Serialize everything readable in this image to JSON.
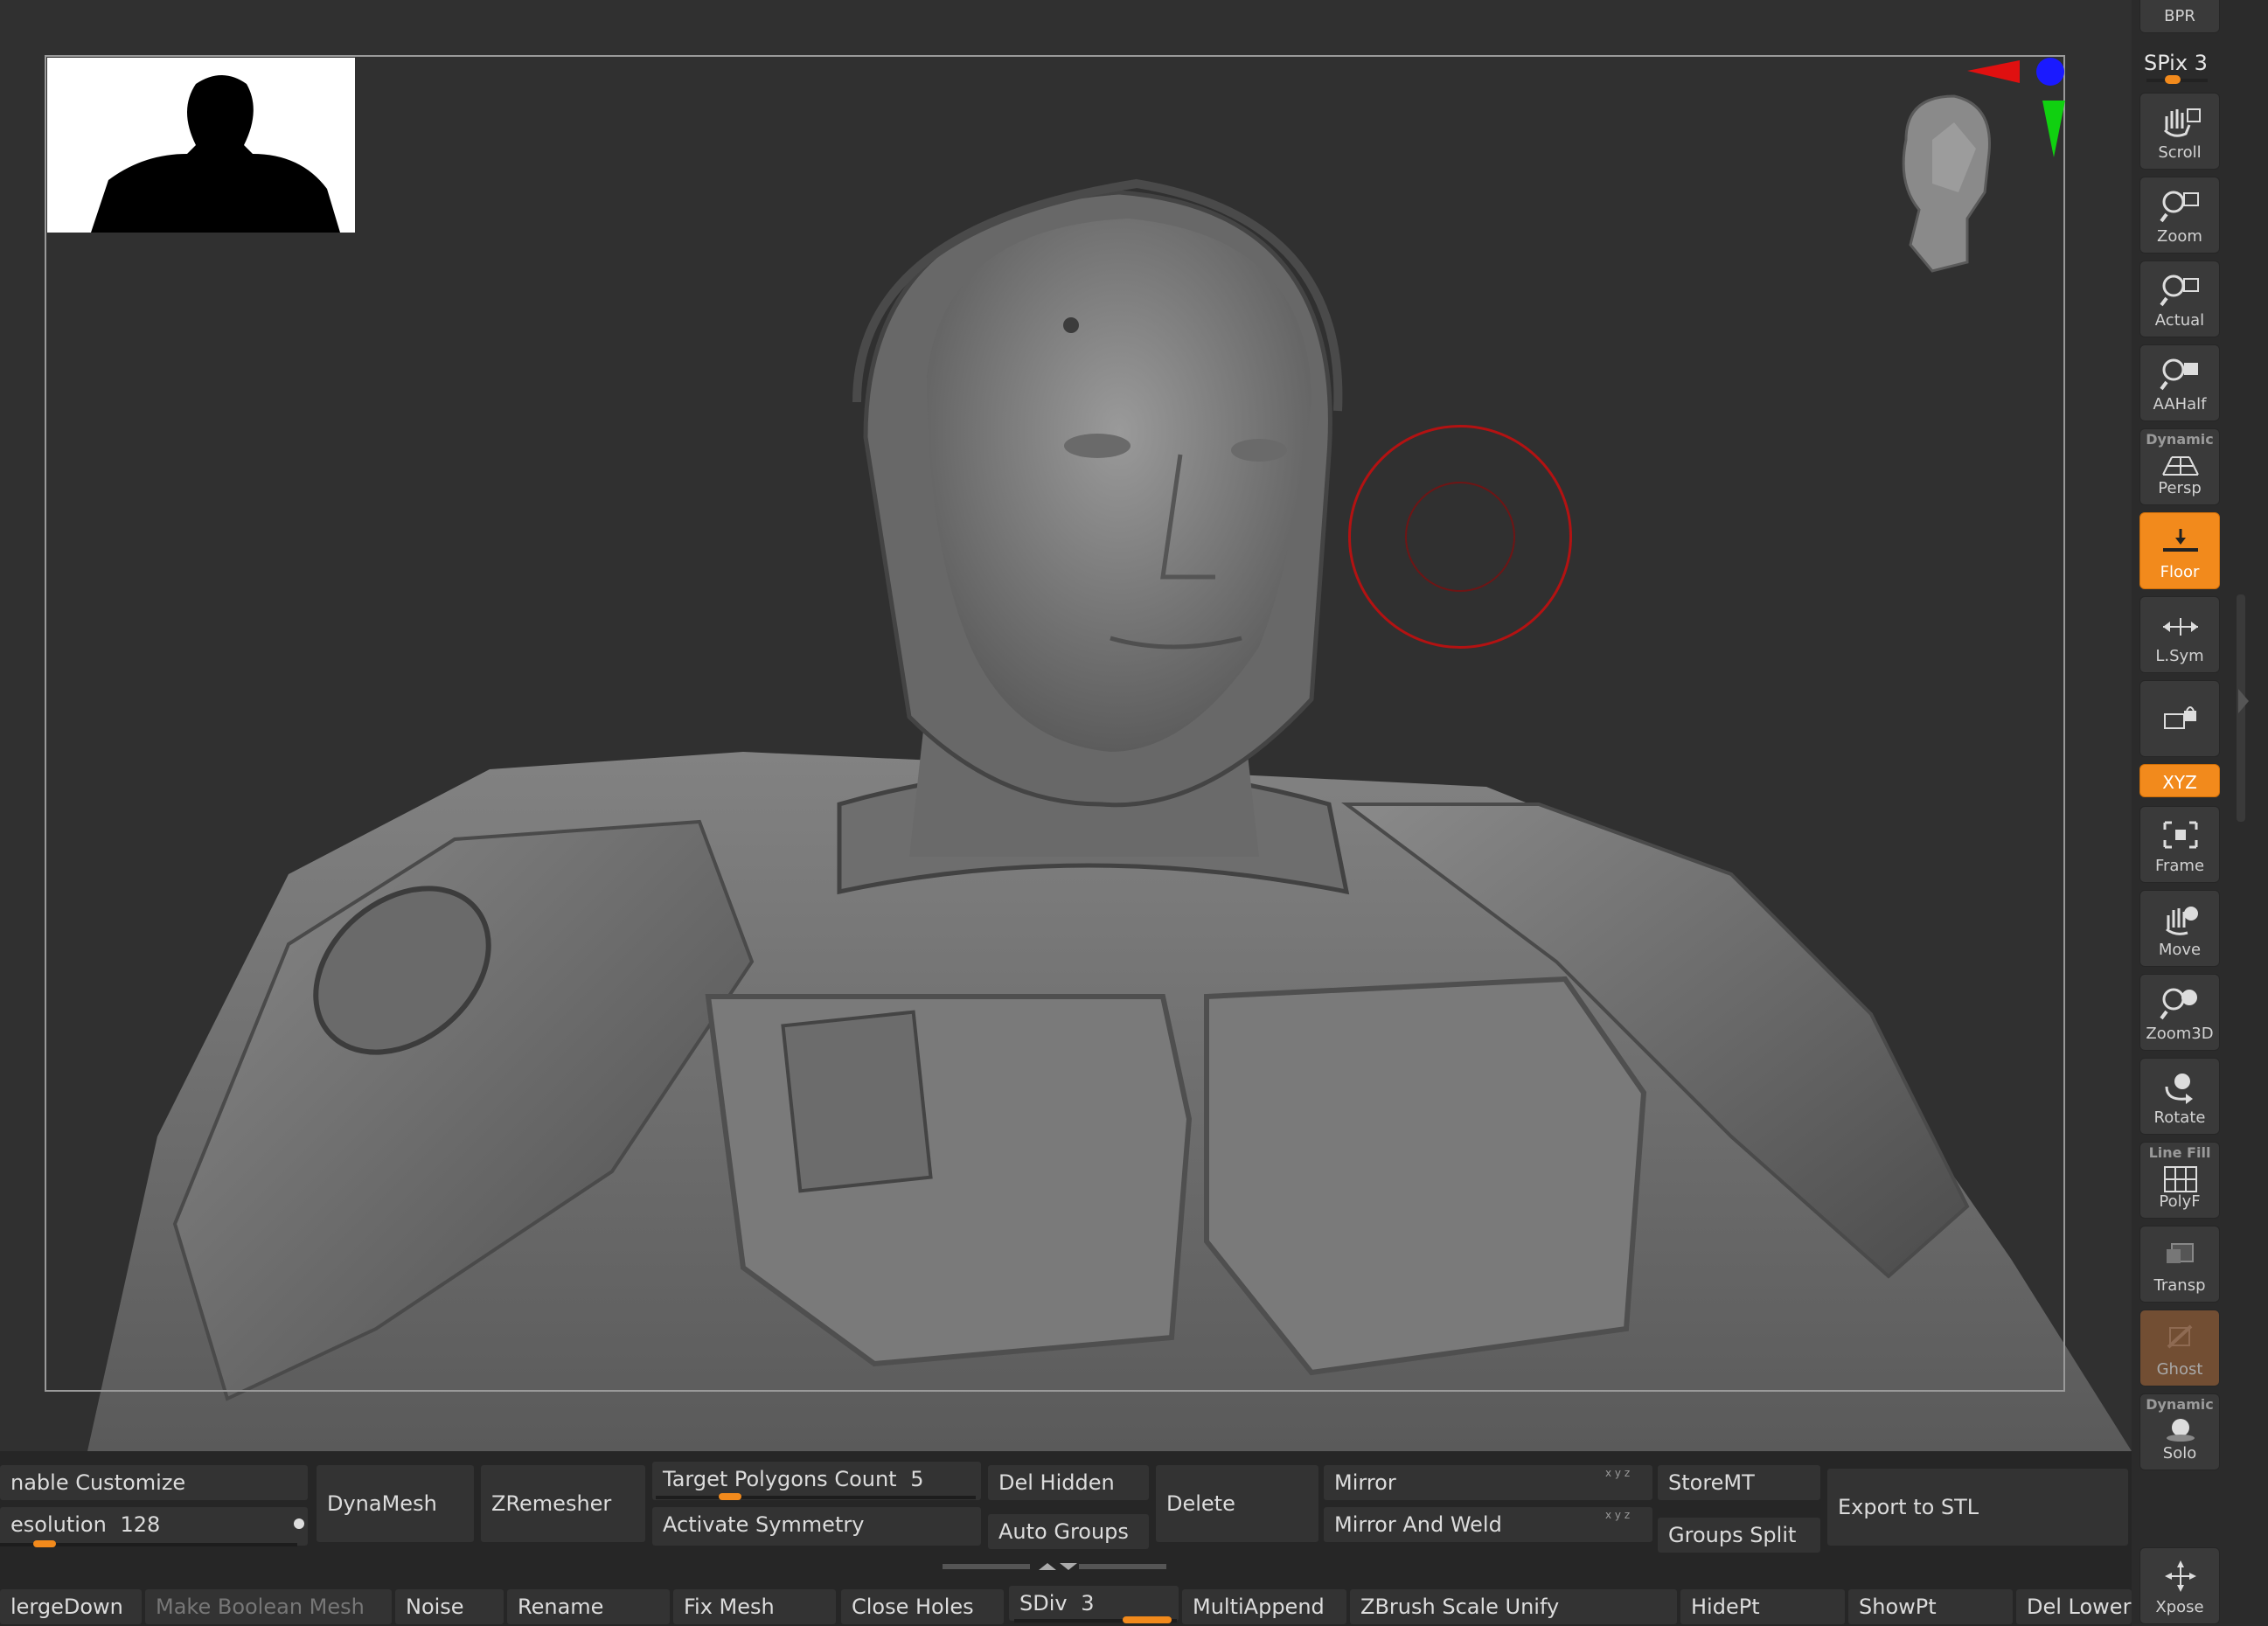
{
  "viewport": {
    "brush_color": "#b31212"
  },
  "right_shelf": {
    "bpr_label": "BPR",
    "spix_label": "SPix 3",
    "buttons": [
      {
        "label": "Scroll",
        "icon": "hand-scroll-icon"
      },
      {
        "label": "Zoom",
        "icon": "zoom-icon"
      },
      {
        "label": "Actual",
        "icon": "actual-size-icon"
      },
      {
        "label": "AAHalf",
        "icon": "aahalf-icon"
      },
      {
        "label": "Persp",
        "top": "Dynamic",
        "icon": "perspective-grid-icon"
      },
      {
        "label": "Floor",
        "icon": "floor-icon",
        "active": true
      },
      {
        "label": "L.Sym",
        "icon": "local-symmetry-icon"
      },
      {
        "label": "",
        "icon": "lock-camera-icon"
      },
      {
        "label": "XYZ",
        "icon": "xyz-rotate-icon",
        "active": true
      },
      {
        "label": "Frame",
        "icon": "frame-icon"
      },
      {
        "label": "Move",
        "icon": "move-hand-icon"
      },
      {
        "label": "Zoom3D",
        "icon": "zoom3d-icon"
      },
      {
        "label": "Rotate",
        "icon": "rotate-icon"
      },
      {
        "label": "PolyF",
        "top": "Line Fill",
        "icon": "polyframe-icon"
      },
      {
        "label": "Transp",
        "icon": "transparency-icon"
      },
      {
        "label": "Ghost",
        "icon": "ghost-icon"
      },
      {
        "label": "Solo",
        "top": "Dynamic",
        "icon": "solo-icon"
      },
      {
        "label": "Xpose",
        "icon": "xpose-icon"
      }
    ],
    "accent": "#f28a1c"
  },
  "bottom": {
    "enable_customize": "nable Customize",
    "resolution_label": "esolution",
    "resolution_value": "128",
    "dynamesh": "DynaMesh",
    "zremesher": "ZRemesher",
    "target_polygons_label": "Target Polygons Count",
    "target_polygons_value": "5",
    "activate_symmetry": "Activate Symmetry",
    "del_hidden": "Del Hidden",
    "auto_groups": "Auto Groups",
    "delete": "Delete",
    "mirror": "Mirror",
    "mirror_and_weld": "Mirror And Weld",
    "storemt": "StoreMT",
    "groups_split": "Groups Split",
    "export_stl": "Export to STL",
    "merge_down": "lergeDown",
    "make_boolean_mesh": "Make Boolean Mesh",
    "noise": "Noise",
    "rename": "Rename",
    "fix_mesh": "Fix Mesh",
    "close_holes": "Close Holes",
    "sdiv_label": "SDiv",
    "sdiv_value": "3",
    "multiappend": "MultiAppend",
    "zbrush_scale_unify": "ZBrush Scale Unify",
    "hidept": "HidePt",
    "showpt": "ShowPt",
    "del_lower": "Del Lower",
    "axis_marks": "x y z"
  }
}
